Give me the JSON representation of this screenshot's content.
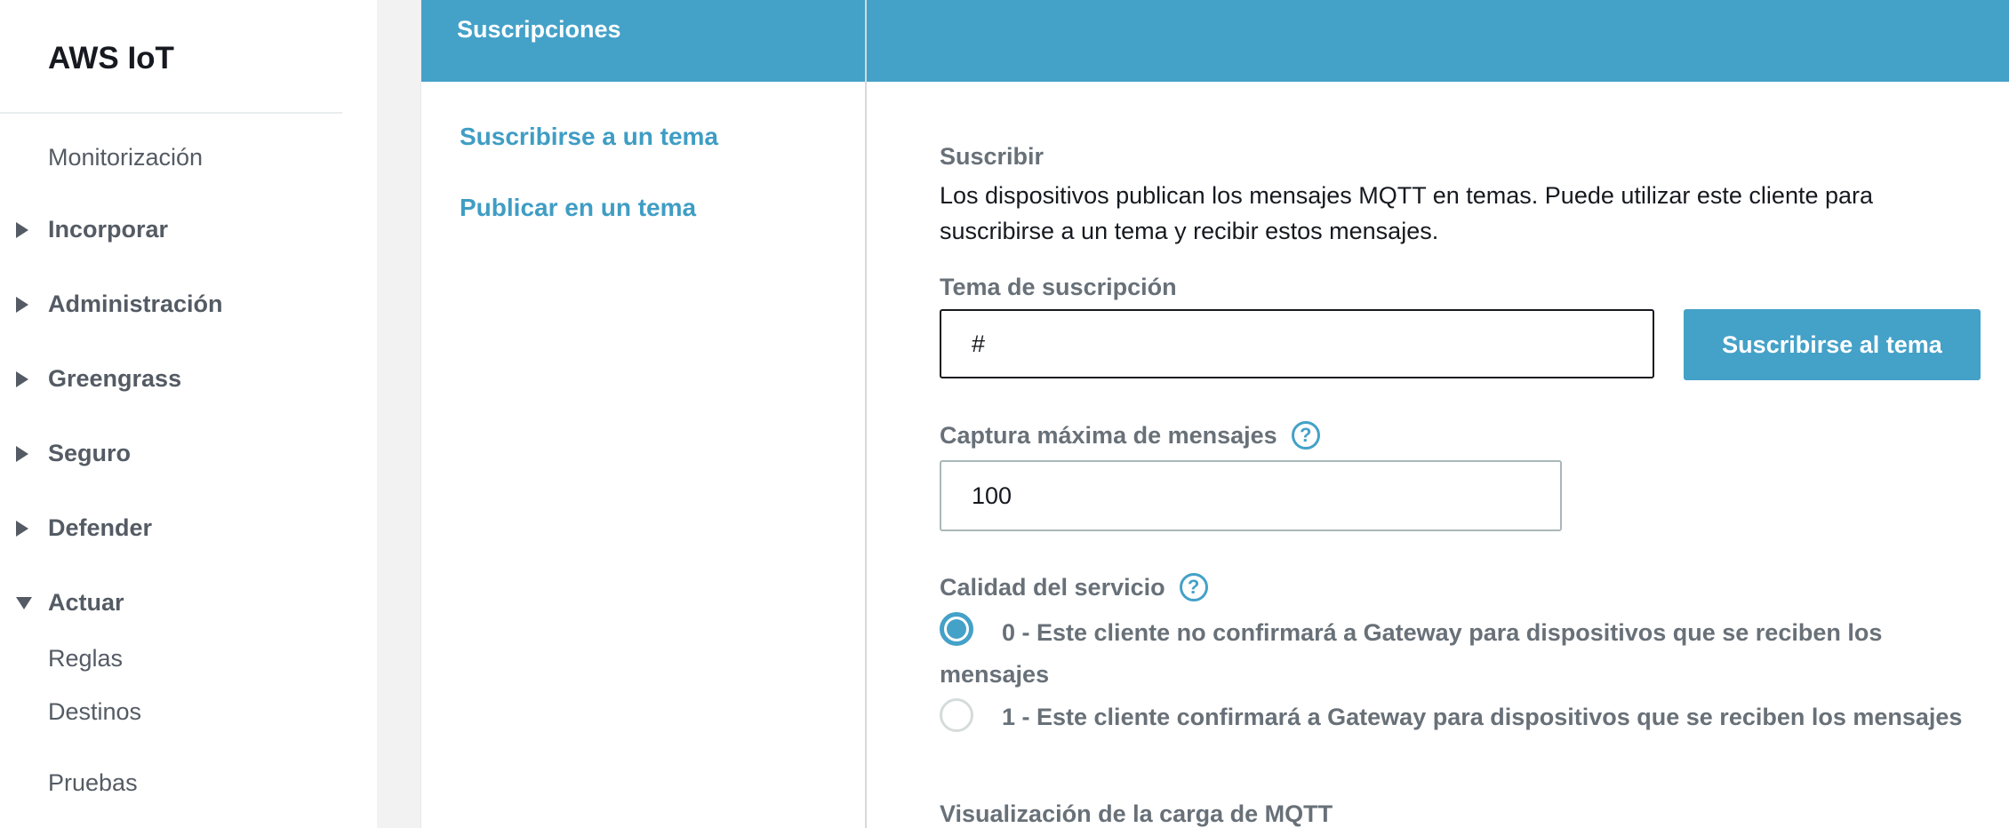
{
  "sidebar": {
    "brand": "AWS IoT",
    "items": [
      {
        "label": "Monitorización"
      },
      {
        "label": "Incorporar"
      },
      {
        "label": "Administración"
      },
      {
        "label": "Greengrass"
      },
      {
        "label": "Seguro"
      },
      {
        "label": "Defender"
      },
      {
        "label": "Actuar"
      },
      {
        "label": "Reglas"
      },
      {
        "label": "Destinos"
      },
      {
        "label": "Pruebas"
      }
    ]
  },
  "subscriptions": {
    "title": "Suscripciones",
    "links": [
      {
        "label": "Suscribirse a un tema"
      },
      {
        "label": "Publicar en un tema"
      }
    ]
  },
  "main": {
    "section_title": "Suscribir",
    "description": "Los dispositivos publican los mensajes MQTT en temas. Puede utilizar este cliente para suscribirse a un tema y recibir estos mensajes.",
    "topic": {
      "label": "Tema de suscripción",
      "value": "#"
    },
    "subscribe_button": "Suscribirse al tema",
    "max_capture": {
      "label": "Captura máxima de mensajes",
      "value": "100"
    },
    "qos": {
      "label": "Calidad del servicio",
      "options": [
        {
          "label": "0 - Este cliente no confirmará a Gateway para dispositivos que se reciben los mensajes",
          "selected": true
        },
        {
          "label": "1 - Este cliente confirmará a Gateway para dispositivos que se reciben los mensajes",
          "selected": false
        }
      ]
    },
    "payload_display": {
      "label": "Visualización de la carga de MQTT"
    },
    "help_icon": "?"
  },
  "colors": {
    "accent": "#44a1c8",
    "link": "#3f9dc4",
    "muted": "#687078"
  }
}
